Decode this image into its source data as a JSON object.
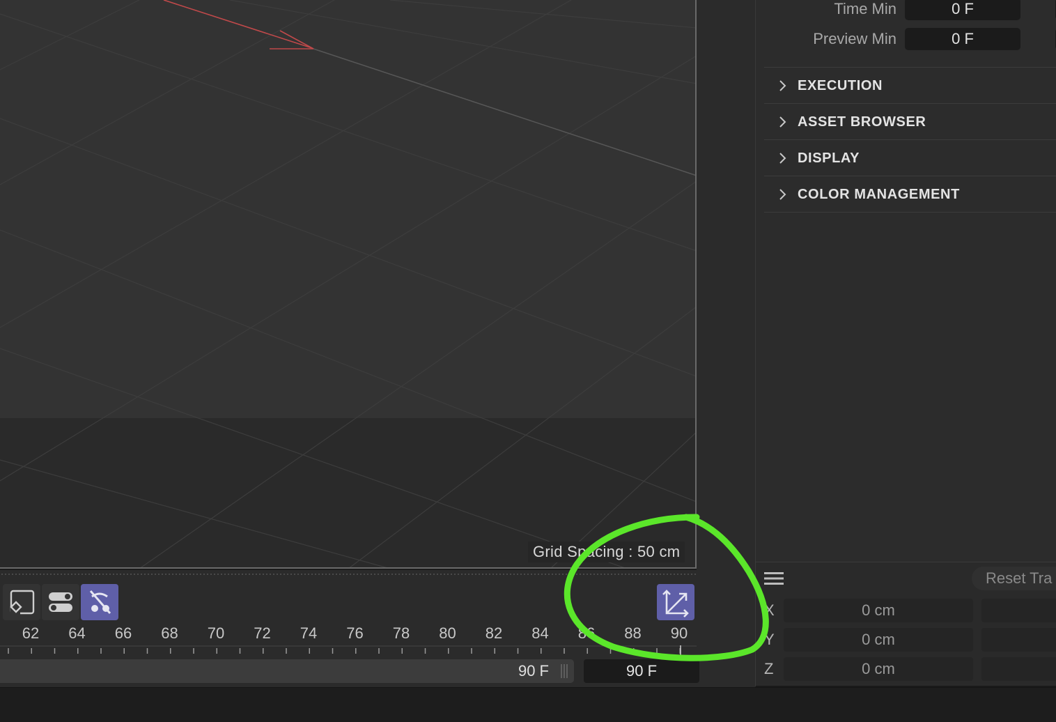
{
  "viewport": {
    "grid_spacing_label": "Grid Spacing : 50 cm"
  },
  "attributes": {
    "fields": [
      {
        "label": "Time Min",
        "value": "0 F"
      },
      {
        "label": "Preview Min",
        "value": "0 F"
      }
    ],
    "sections": [
      {
        "title": "EXECUTION"
      },
      {
        "title": "ASSET BROWSER"
      },
      {
        "title": "DISPLAY"
      },
      {
        "title": "COLOR MANAGEMENT"
      }
    ]
  },
  "coordinates": {
    "reset_label": "Reset Tra",
    "rows": [
      {
        "axis": "X",
        "value": "0 cm"
      },
      {
        "axis": "Y",
        "value": "0 cm"
      },
      {
        "axis": "Z",
        "value": "0 cm"
      }
    ]
  },
  "timeline": {
    "ticks": [
      "62",
      "64",
      "66",
      "68",
      "70",
      "72",
      "74",
      "76",
      "78",
      "80",
      "82",
      "84",
      "86",
      "88",
      "90"
    ],
    "range_end_label": "90 F",
    "end_field_value": "90 F",
    "tools": [
      {
        "icon": "keyframe-selection-icon",
        "active": false
      },
      {
        "icon": "toggle-switches-icon",
        "active": false
      },
      {
        "icon": "disable-key-icon",
        "active": true
      },
      {
        "icon": "f-curve-mode-icon",
        "active": true
      }
    ]
  },
  "colors": {
    "active_button": "#5f5fa8",
    "annotation": "#5be62a",
    "axis_x": "#c0494a"
  }
}
